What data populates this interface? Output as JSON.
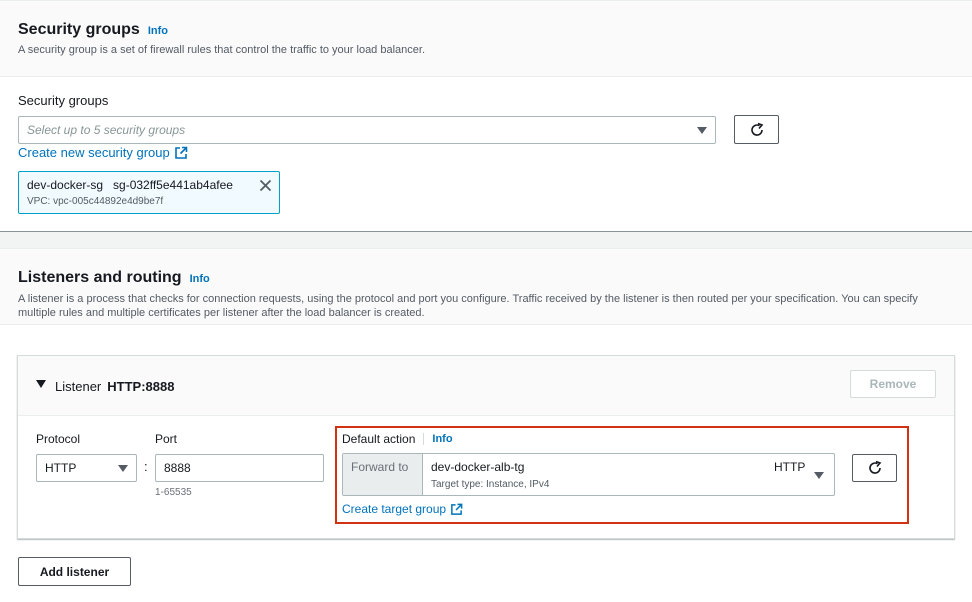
{
  "security_groups": {
    "title": "Security groups",
    "info": "Info",
    "description": "A security group is a set of firewall rules that control the traffic to your load balancer.",
    "field_label": "Security groups",
    "select_placeholder": "Select up to 5 security groups",
    "create_link": "Create new security group",
    "selected": {
      "name": "dev-docker-sg",
      "id": "sg-032ff5e441ab4afee",
      "vpc": "VPC: vpc-005c44892e4d9be7f"
    }
  },
  "listeners": {
    "title": "Listeners and routing",
    "info": "Info",
    "description_line1": "A listener is a process that checks for connection requests, using the protocol and port you configure. Traffic received by the listener is then routed per your specification. You can specify",
    "description_line2": "multiple rules and multiple certificates per listener after the load balancer is created.",
    "listener": {
      "label": "Listener",
      "name": "HTTP:8888",
      "remove_label": "Remove",
      "protocol_label": "Protocol",
      "protocol_value": "HTTP",
      "separator": ":",
      "port_label": "Port",
      "port_value": "8888",
      "port_hint": "1-65535",
      "default_action_label": "Default action",
      "default_action_info": "Info",
      "forward_to_label": "Forward to",
      "target_group_name": "dev-docker-alb-tg",
      "target_group_protocol": "HTTP",
      "target_type": "Target type: Instance, IPv4",
      "create_target_group": "Create target group"
    },
    "add_listener_label": "Add listener"
  }
}
